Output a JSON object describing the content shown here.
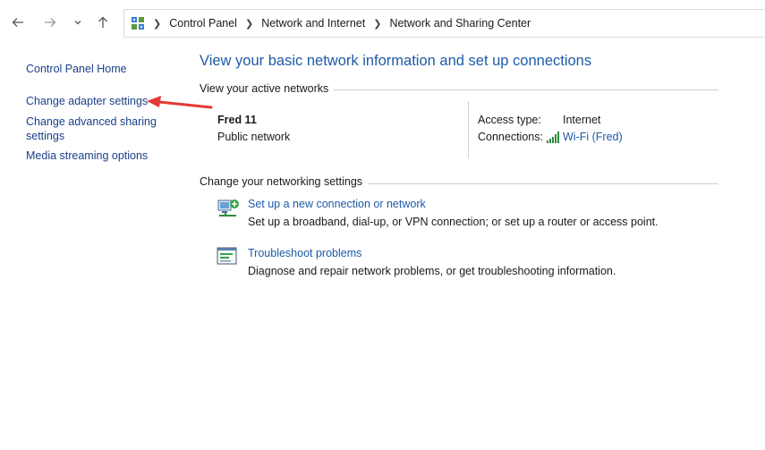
{
  "nav": {
    "back_icon": "arrow-left-icon",
    "forward_icon": "arrow-right-icon",
    "recent_icon": "chevron-down-icon",
    "up_icon": "arrow-up-icon"
  },
  "breadcrumb": {
    "icon": "control-panel-icon",
    "items": [
      "Control Panel",
      "Network and Internet",
      "Network and Sharing Center"
    ]
  },
  "sidebar": {
    "items": [
      {
        "label": "Control Panel Home"
      },
      {
        "label": "Change adapter settings"
      },
      {
        "label": "Change advanced sharing settings"
      },
      {
        "label": "Media streaming options"
      }
    ]
  },
  "main": {
    "title": "View your basic network information and set up connections",
    "active_networks_heading": "View your active networks",
    "network": {
      "name": "Fred 11",
      "type": "Public network",
      "access_type_label": "Access type:",
      "access_type_value": "Internet",
      "connections_label": "Connections:",
      "connection_link": "Wi-Fi (Fred)"
    },
    "settings_heading": "Change your networking settings",
    "tasks": [
      {
        "icon": "new-connection-icon",
        "link": "Set up a new connection or network",
        "desc": "Set up a broadband, dial-up, or VPN connection; or set up a router or access point."
      },
      {
        "icon": "troubleshoot-icon",
        "link": "Troubleshoot problems",
        "desc": "Diagnose and repair network problems, or get troubleshooting information."
      }
    ]
  },
  "annotation": {
    "arrow_color": "#e53935"
  },
  "colors": {
    "link": "#1e5aa8",
    "sidebar_link": "#1a3f8b"
  }
}
